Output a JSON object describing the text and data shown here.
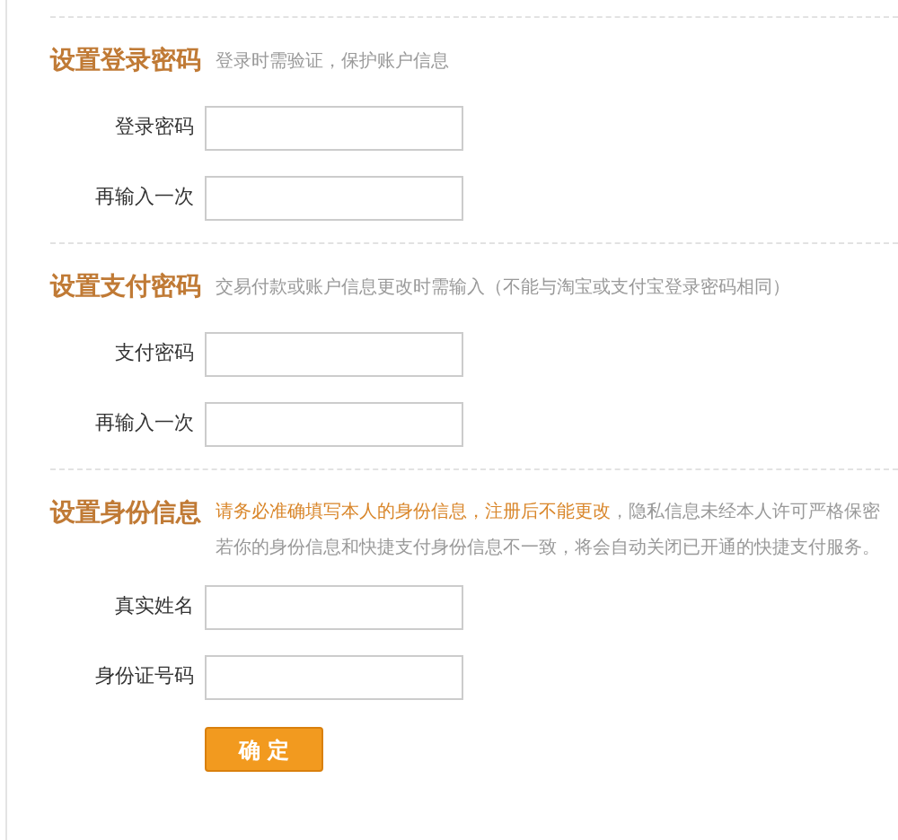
{
  "sections": [
    {
      "title": "设置登录密码",
      "note": [
        [
          {
            "text": "登录时需验证，保护账户信息",
            "highlight": false
          }
        ]
      ],
      "fields": [
        {
          "label": "登录密码"
        },
        {
          "label": "再输入一次"
        }
      ]
    },
    {
      "title": "设置支付密码",
      "note": [
        [
          {
            "text": "交易付款或账户信息更改时需输入（不能与淘宝或支付宝登录密码相同）",
            "highlight": false
          }
        ]
      ],
      "fields": [
        {
          "label": "支付密码"
        },
        {
          "label": "再输入一次"
        }
      ]
    },
    {
      "title": "设置身份信息",
      "note": [
        [
          {
            "text": "请务必准确填写本人的身份信息，注册后不能更改",
            "highlight": true
          },
          {
            "text": "，隐私信息未经本人许可严格保密",
            "highlight": false
          }
        ],
        [
          {
            "text": "若你的身份信息和快捷支付身份信息不一致，将会自动关闭已开通的快捷支付服务。",
            "highlight": false
          }
        ]
      ],
      "fields": [
        {
          "label": "真实姓名"
        },
        {
          "label": "身份证号码"
        }
      ]
    }
  ],
  "submit_button": "确 定"
}
